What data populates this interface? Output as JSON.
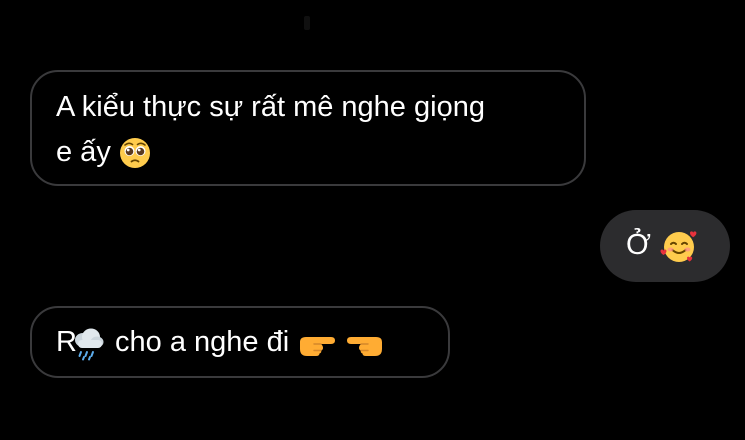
{
  "conversation": {
    "messages": [
      {
        "direction": "incoming",
        "text_line1": "A kiểu thực sự rất mê nghe giọng",
        "text_line2": "e ấy",
        "emoji": "pleading-face-icon"
      },
      {
        "direction": "outgoing",
        "text": "Ở",
        "emoji": "smiling-face-with-hearts-icon"
      },
      {
        "direction": "incoming",
        "text_start": "R",
        "text_rest": "cho a nghe đi",
        "emojis": [
          "rain-cloud-icon",
          "pointing-right-icon",
          "pointing-left-icon"
        ]
      }
    ]
  },
  "colors": {
    "background": "#000000",
    "incoming_border": "#3a3a3c",
    "outgoing_bubble": "#2c2c2e",
    "text": "#ffffff"
  }
}
